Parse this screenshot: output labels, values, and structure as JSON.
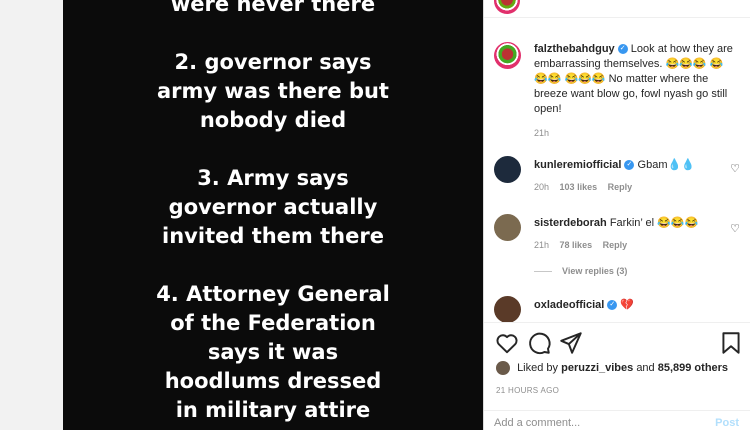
{
  "image": {
    "lines": [
      "were never there",
      "",
      "2. governor says",
      "army was there but",
      "nobody died",
      "",
      "3. Army says",
      "governor actually",
      "invited them there",
      "",
      "4. Attorney General",
      "of the Federation",
      "says it was",
      "hoodlums dressed",
      "in military attire"
    ]
  },
  "caption": {
    "username": "falzthebahdguy",
    "text": "Look at how they are embarrassing themselves. 😂😂😂 😂😂😂 😂😂😂 No matter where the breeze want blow go, fowl nyash go still open!",
    "time": "21h"
  },
  "comments": [
    {
      "username": "kunleremiofficial",
      "text": "Gbam💧💧",
      "time": "20h",
      "likes": "103 likes",
      "reply": "Reply"
    },
    {
      "username": "sisterdeborah",
      "text": "Farkin’ el 😂😂😂",
      "time": "21h",
      "likes": "78 likes",
      "reply": "Reply",
      "view_replies": "View replies (3)"
    },
    {
      "username": "oxladeofficial",
      "text": "💔"
    }
  ],
  "liked_by": {
    "prefix": "Liked by",
    "user": "peruzzi_vibes",
    "and": "and",
    "count": "85,899 others"
  },
  "time_ago": "21 HOURS AGO",
  "add_comment": {
    "placeholder": "Add a comment...",
    "post": "Post"
  },
  "colors": {
    "verified": "#3897f0",
    "link": "#b2dffc",
    "muted": "#8e8e8e"
  }
}
